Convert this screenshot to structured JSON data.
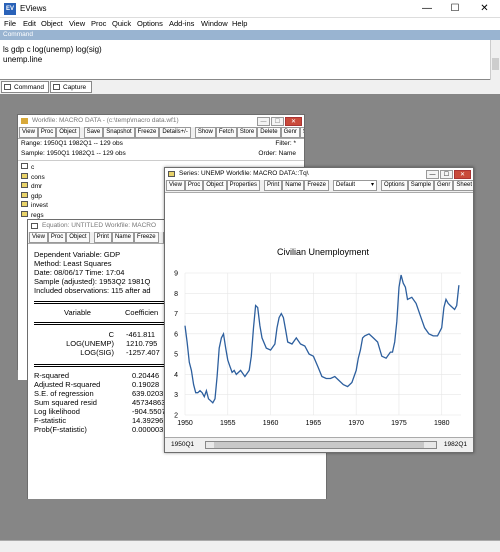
{
  "app": {
    "title": "EViews"
  },
  "menu": [
    "File",
    "Edit",
    "Object",
    "View",
    "Proc",
    "Quick",
    "Options",
    "Add-ins",
    "Window",
    "Help"
  ],
  "command": {
    "label": "Command",
    "lines": [
      "ls gdp c log(unemp) log(sig)",
      "unemp.line"
    ]
  },
  "tabs": {
    "command": "Command",
    "capture": "Capture"
  },
  "workfile": {
    "title": "Workfile: MACRO DATA - (c:\\temp\\macro data.wf1)",
    "toolbar": [
      "View",
      "Proc",
      "Object",
      "Save",
      "Snapshot",
      "Freeze",
      "Details+/-",
      "Show",
      "Fetch",
      "Store",
      "Delete",
      "Genr",
      "Sa"
    ],
    "range_label": "Range:  1950Q1 1982Q1  --  129 obs",
    "sample_label": "Sample: 1950Q1 1982Q1  --  129 obs",
    "filter_label": "Filter: *",
    "order_label": "Order: Name",
    "objects": [
      "c",
      "cons",
      "dmr",
      "gdp",
      "invest",
      "regs"
    ]
  },
  "equation": {
    "title": "Equation: UNTITLED   Workfile: MACRO",
    "toolbar": [
      "View",
      "Proc",
      "Object",
      "Print",
      "Name",
      "Freeze",
      "E"
    ],
    "header": [
      "Dependent Variable: GDP",
      "Method: Least Squares",
      "Date: 08/06/17   Time: 17:04",
      "Sample (adjusted): 1953Q2 1981Q",
      "Included observations: 115 after ad"
    ],
    "col_variable": "Variable",
    "col_coef": "Coefficien",
    "rows": [
      {
        "var": "C",
        "coef": "-461.811"
      },
      {
        "var": "LOG(UNEMP)",
        "coef": "1210.795"
      },
      {
        "var": "LOG(SIG)",
        "coef": "-1257.407"
      }
    ],
    "stats": [
      {
        "label": "R-squared",
        "value": "0.20446"
      },
      {
        "label": "Adjusted R-squared",
        "value": "0.19028"
      },
      {
        "label": "S.E. of regression",
        "value": "639.0203"
      },
      {
        "label": "Sum squared resid",
        "value": "45734863"
      },
      {
        "label": "Log likelihood",
        "value": "-904.5507"
      },
      {
        "label": "F-statistic",
        "value": "14.39296"
      },
      {
        "label": "Prob(F-statistic)",
        "value": "0.000003"
      }
    ]
  },
  "series": {
    "title": "Series: UNEMP   Workfile: MACRO DATA::Tq\\",
    "toolbar": [
      "View",
      "Proc",
      "Object",
      "Properties",
      "Print",
      "Name",
      "Freeze",
      "Default",
      "Options",
      "Sample",
      "Genr",
      "Sheet",
      "S"
    ],
    "scroll_left": "1950Q1",
    "scroll_right": "1982Q1"
  },
  "chart_data": {
    "type": "line",
    "title": "Civilian Unemployment",
    "xlabel": "",
    "ylabel": "",
    "ylim": [
      2,
      9
    ],
    "xlim": [
      1950,
      1982.25
    ],
    "x_ticks": [
      1950,
      1955,
      1960,
      1965,
      1970,
      1975,
      1980
    ],
    "y_ticks": [
      2,
      3,
      4,
      5,
      6,
      7,
      8,
      9
    ],
    "grid": true,
    "series": [
      {
        "color": "#2d5f9e",
        "x": [
          1950,
          1950.25,
          1950.5,
          1950.75,
          1951,
          1951.25,
          1951.5,
          1951.75,
          1952,
          1952.25,
          1952.5,
          1952.75,
          1953,
          1953.25,
          1953.5,
          1953.75,
          1954,
          1954.25,
          1954.5,
          1954.75,
          1955,
          1955.25,
          1955.5,
          1955.75,
          1956,
          1956.5,
          1957,
          1957.5,
          1957.75,
          1958,
          1958.25,
          1958.5,
          1958.75,
          1959,
          1959.5,
          1960,
          1960.5,
          1960.75,
          1961,
          1961.25,
          1961.5,
          1961.75,
          1962,
          1962.5,
          1963,
          1963.5,
          1964,
          1964.5,
          1965,
          1965.5,
          1966,
          1966.5,
          1967,
          1967.5,
          1968,
          1968.5,
          1969,
          1969.5,
          1970,
          1970.25,
          1970.5,
          1970.75,
          1971,
          1971.5,
          1972,
          1972.5,
          1973,
          1973.5,
          1974,
          1974.25,
          1974.5,
          1974.75,
          1975,
          1975.25,
          1975.5,
          1975.75,
          1976,
          1976.5,
          1977,
          1977.5,
          1978,
          1978.5,
          1979,
          1979.5,
          1980,
          1980.25,
          1980.5,
          1980.75,
          1981,
          1981.5,
          1981.75,
          1982
        ],
        "values": [
          6.4,
          5.6,
          4.6,
          4.2,
          3.5,
          3.1,
          3.1,
          3.2,
          3.1,
          2.9,
          3.2,
          2.8,
          2.7,
          2.6,
          2.8,
          3.9,
          5.3,
          5.8,
          6.0,
          5.3,
          4.7,
          4.4,
          4.1,
          4.2,
          4.0,
          4.2,
          3.9,
          4.2,
          4.9,
          6.3,
          7.4,
          7.3,
          6.4,
          5.8,
          5.3,
          5.2,
          5.5,
          6.3,
          6.8,
          7.0,
          6.8,
          6.2,
          5.6,
          5.5,
          5.8,
          5.5,
          5.4,
          5.0,
          4.9,
          4.4,
          3.9,
          3.8,
          3.8,
          3.9,
          3.7,
          3.5,
          3.4,
          3.6,
          4.2,
          4.8,
          5.2,
          5.8,
          5.9,
          6.0,
          5.8,
          5.6,
          4.9,
          4.8,
          5.1,
          5.1,
          5.6,
          6.6,
          8.3,
          8.9,
          8.5,
          8.3,
          7.7,
          7.8,
          7.5,
          6.9,
          6.3,
          6.0,
          5.9,
          5.9,
          6.3,
          7.3,
          7.7,
          7.5,
          7.4,
          7.2,
          7.4,
          8.4
        ]
      }
    ]
  }
}
